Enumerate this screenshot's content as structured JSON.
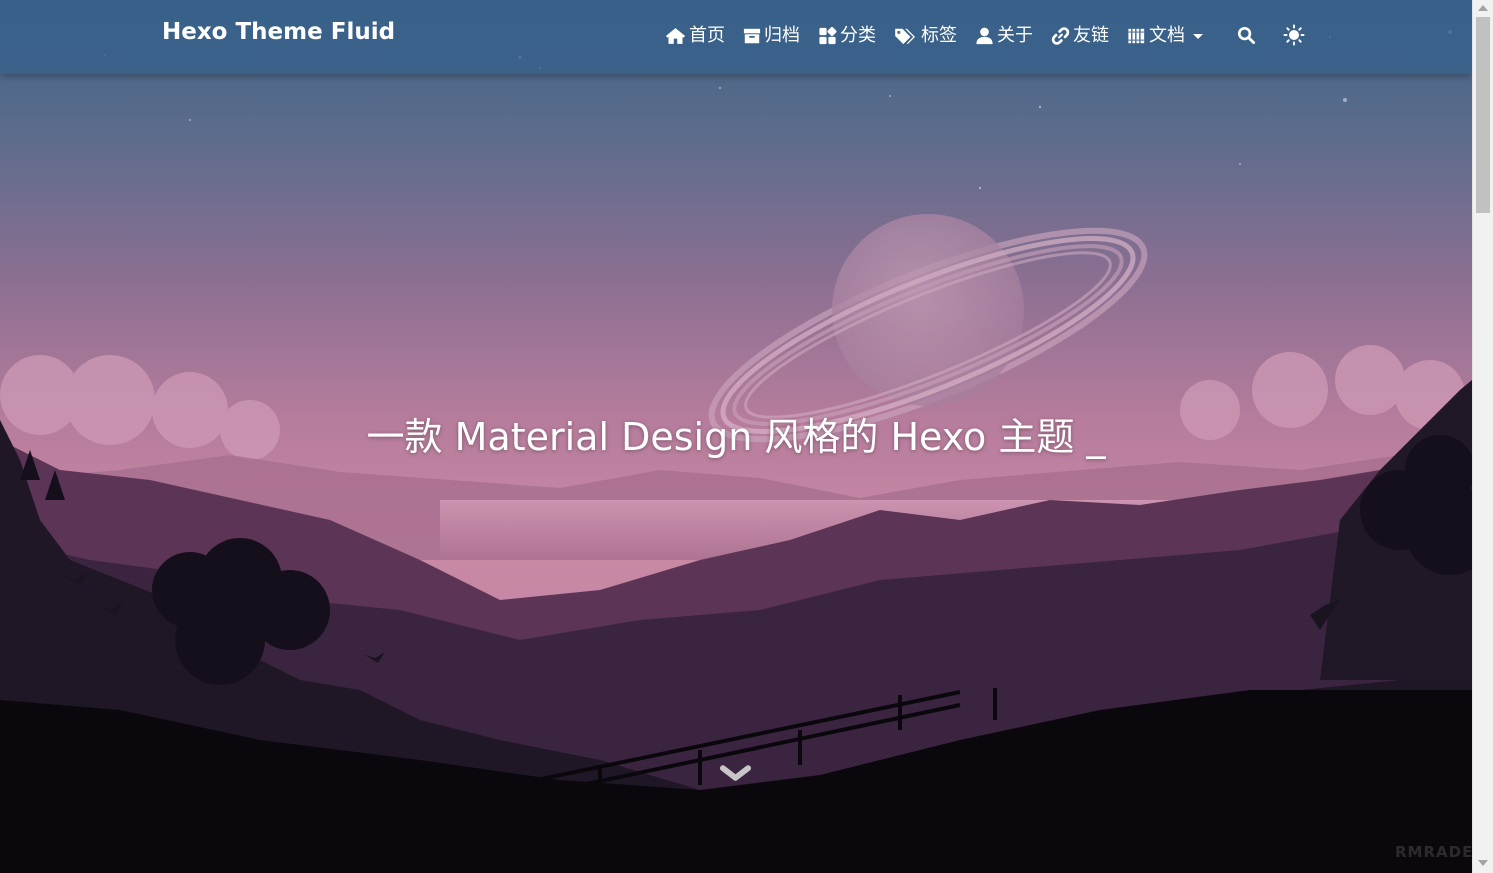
{
  "navbar": {
    "brand": "Hexo Theme Fluid",
    "items": [
      {
        "icon": "home-icon",
        "label": "首页"
      },
      {
        "icon": "archive-icon",
        "label": "归档"
      },
      {
        "icon": "categories-icon",
        "label": "分类"
      },
      {
        "icon": "tags-icon",
        "label": "标签"
      },
      {
        "icon": "user-icon",
        "label": "关于"
      },
      {
        "icon": "link-icon",
        "label": "友链"
      },
      {
        "icon": "docs-icon",
        "label": "文档",
        "dropdown": true
      }
    ],
    "search_icon": "search-icon",
    "theme_toggle_icon": "sun-icon"
  },
  "hero": {
    "slogan": "一款 Material Design 风格的 Hexo 主题 _",
    "scroll_icon": "chevron-down-icon",
    "watermark": "RMRADE"
  },
  "colors": {
    "navbar_bg": "#34608a",
    "sky_top": "#4a6786",
    "sky_mid": "#c07fa0",
    "text": "#ffffff"
  }
}
